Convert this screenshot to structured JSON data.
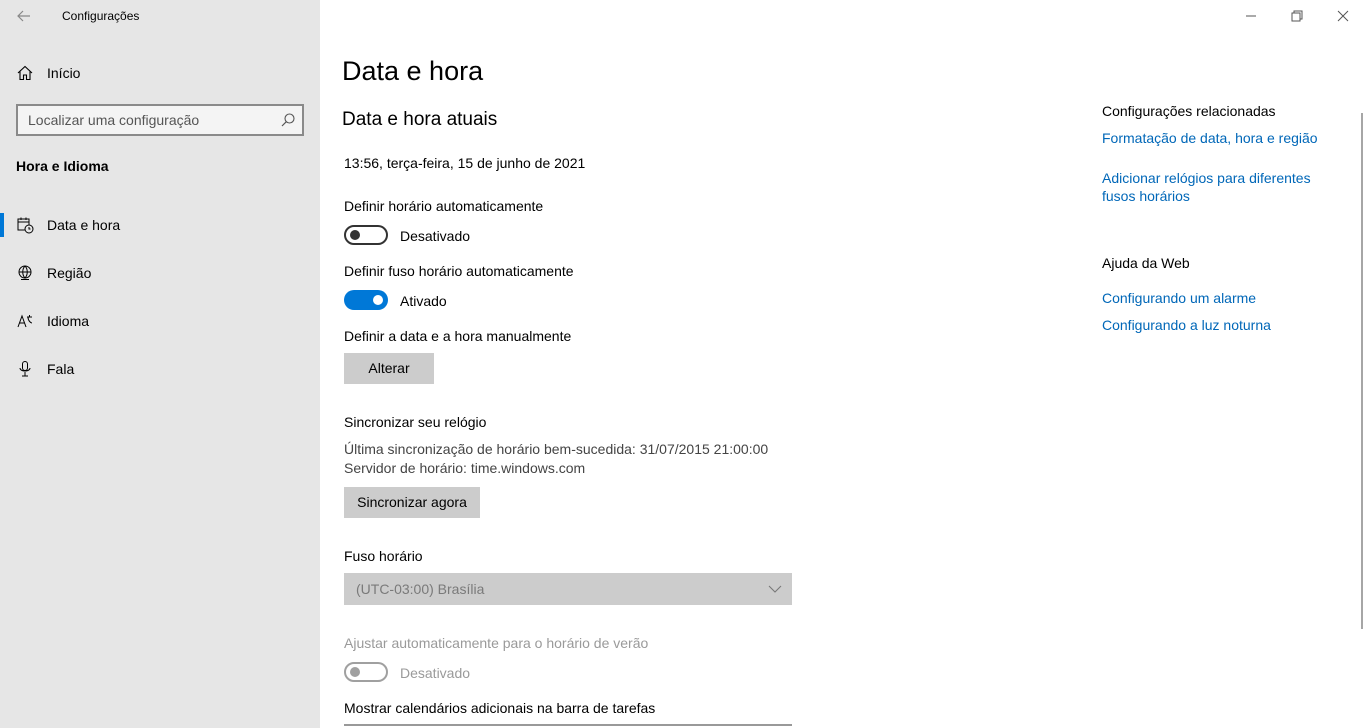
{
  "window": {
    "app_title": "Configurações"
  },
  "sidebar": {
    "home_label": "Início",
    "search_placeholder": "Localizar uma configuração",
    "section_title": "Hora e Idioma",
    "items": [
      {
        "label": "Data e hora",
        "icon": "calendar-clock-icon",
        "active": true
      },
      {
        "label": "Região",
        "icon": "globe-icon",
        "active": false
      },
      {
        "label": "Idioma",
        "icon": "language-icon",
        "active": false
      },
      {
        "label": "Fala",
        "icon": "microphone-icon",
        "active": false
      }
    ]
  },
  "main": {
    "title": "Data e hora",
    "current_heading": "Data e hora atuais",
    "current_datetime": "13:56, terça-feira, 15 de junho de 2021",
    "auto_time": {
      "label": "Definir horário automaticamente",
      "state": "Desativado",
      "on": false
    },
    "auto_timezone": {
      "label": "Definir fuso horário automaticamente",
      "state": "Ativado",
      "on": true
    },
    "manual": {
      "label": "Definir a data e a hora manualmente",
      "button": "Alterar"
    },
    "sync": {
      "title": "Sincronizar seu relógio",
      "last_sync": "Última sincronização de horário bem-sucedida: 31/07/2015 21:00:00",
      "server": "Servidor de horário: time.windows.com",
      "button": "Sincronizar agora"
    },
    "timezone": {
      "label": "Fuso horário",
      "value": "(UTC-03:00) Brasília"
    },
    "dst": {
      "label": "Ajustar automaticamente para o horário de verão",
      "state": "Desativado",
      "enabled": false
    },
    "calendars": {
      "label": "Mostrar calendários adicionais na barra de tarefas"
    }
  },
  "related": {
    "title": "Configurações relacionadas",
    "links": [
      "Formatação de data, hora e região",
      "Adicionar relógios para diferentes fusos horários"
    ]
  },
  "web_help": {
    "title": "Ajuda da Web",
    "links": [
      "Configurando um alarme",
      "Configurando a luz noturna"
    ]
  },
  "colors": {
    "accent": "#0078d7",
    "link": "#0067b8",
    "sidebar_bg": "#e6e6e6",
    "button_bg": "#cccccc"
  }
}
